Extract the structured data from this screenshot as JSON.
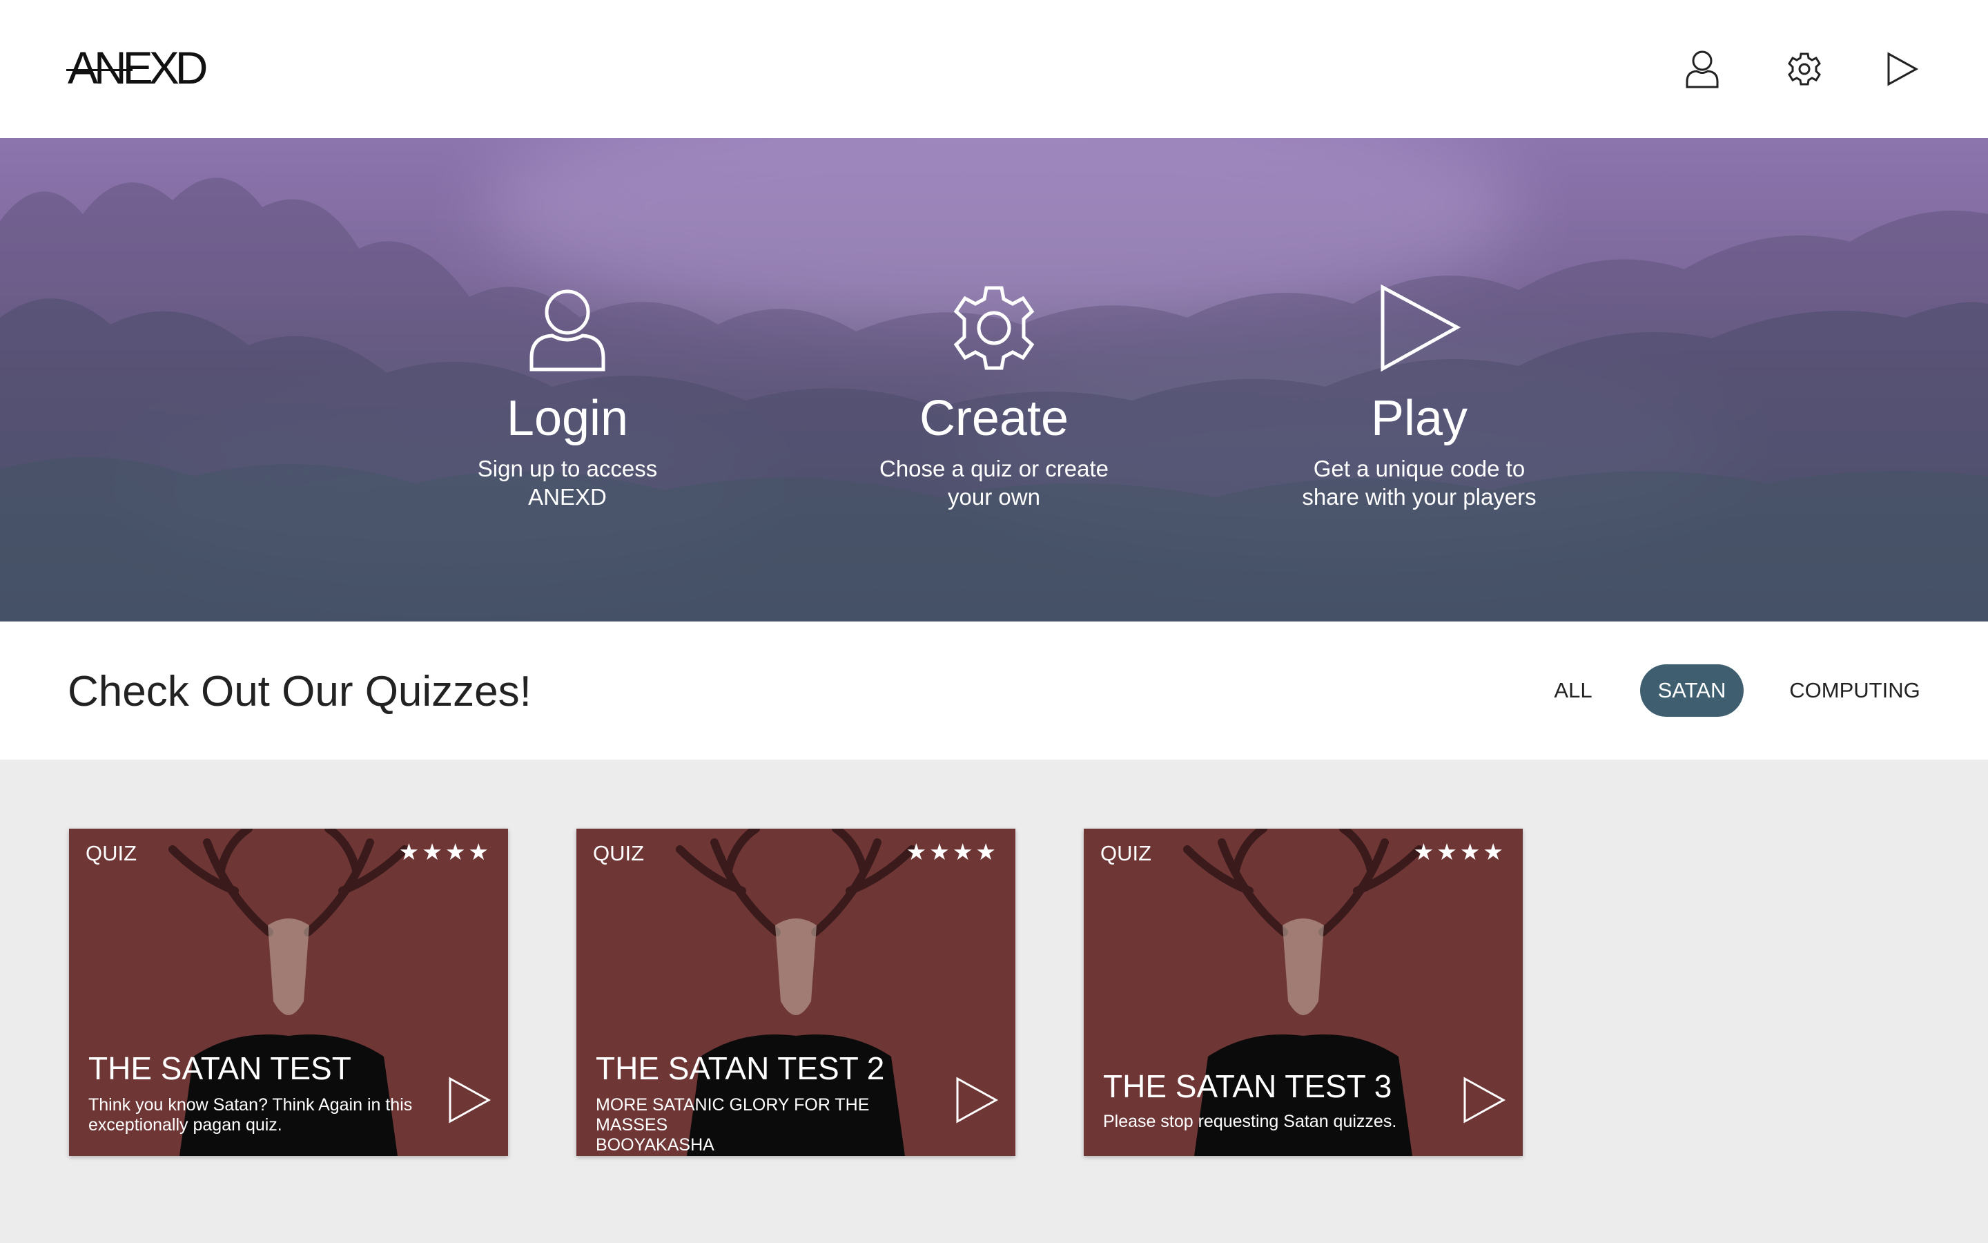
{
  "header": {
    "logo": "ANEXD",
    "nav_icons": [
      "user-icon",
      "gear-icon",
      "play-icon"
    ]
  },
  "hero": {
    "features": [
      {
        "icon": "user-icon",
        "title": "Login",
        "desc_line1": "Sign up to access",
        "desc_line2": "ANEXD"
      },
      {
        "icon": "gear-icon",
        "title": "Create",
        "desc_line1": "Chose a quiz or create",
        "desc_line2": "your own"
      },
      {
        "icon": "play-icon",
        "title": "Play",
        "desc_line1": "Get a unique code to",
        "desc_line2": "share with your players"
      }
    ]
  },
  "quizzes": {
    "heading": "Check Out Our Quizzes!",
    "filters": [
      {
        "label": "ALL",
        "active": false
      },
      {
        "label": "SATAN",
        "active": true
      },
      {
        "label": "COMPUTING",
        "active": false
      }
    ],
    "cards": [
      {
        "tag": "QUIZ",
        "rating": 4,
        "stars": "★★★★",
        "title": "THE SATAN TEST",
        "desc_line1": "Think you know Satan? Think Again in this",
        "desc_line2": "exceptionally pagan quiz."
      },
      {
        "tag": "QUIZ",
        "rating": 4,
        "stars": "★★★★",
        "title": "THE SATAN TEST 2",
        "desc_line1": "MORE SATANIC GLORY FOR THE MASSES",
        "desc_line2": "BOOYAKASHA"
      },
      {
        "tag": "QUIZ",
        "rating": 4,
        "stars": "★★★★",
        "title": "THE SATAN TEST 3",
        "desc_line1": "Please stop requesting Satan quizzes.",
        "desc_line2": ""
      }
    ]
  },
  "colors": {
    "accent": "#3f5f70",
    "card_background": "#6e3535",
    "hero_top": "#8c74ad",
    "hero_bottom": "#3f5866"
  }
}
